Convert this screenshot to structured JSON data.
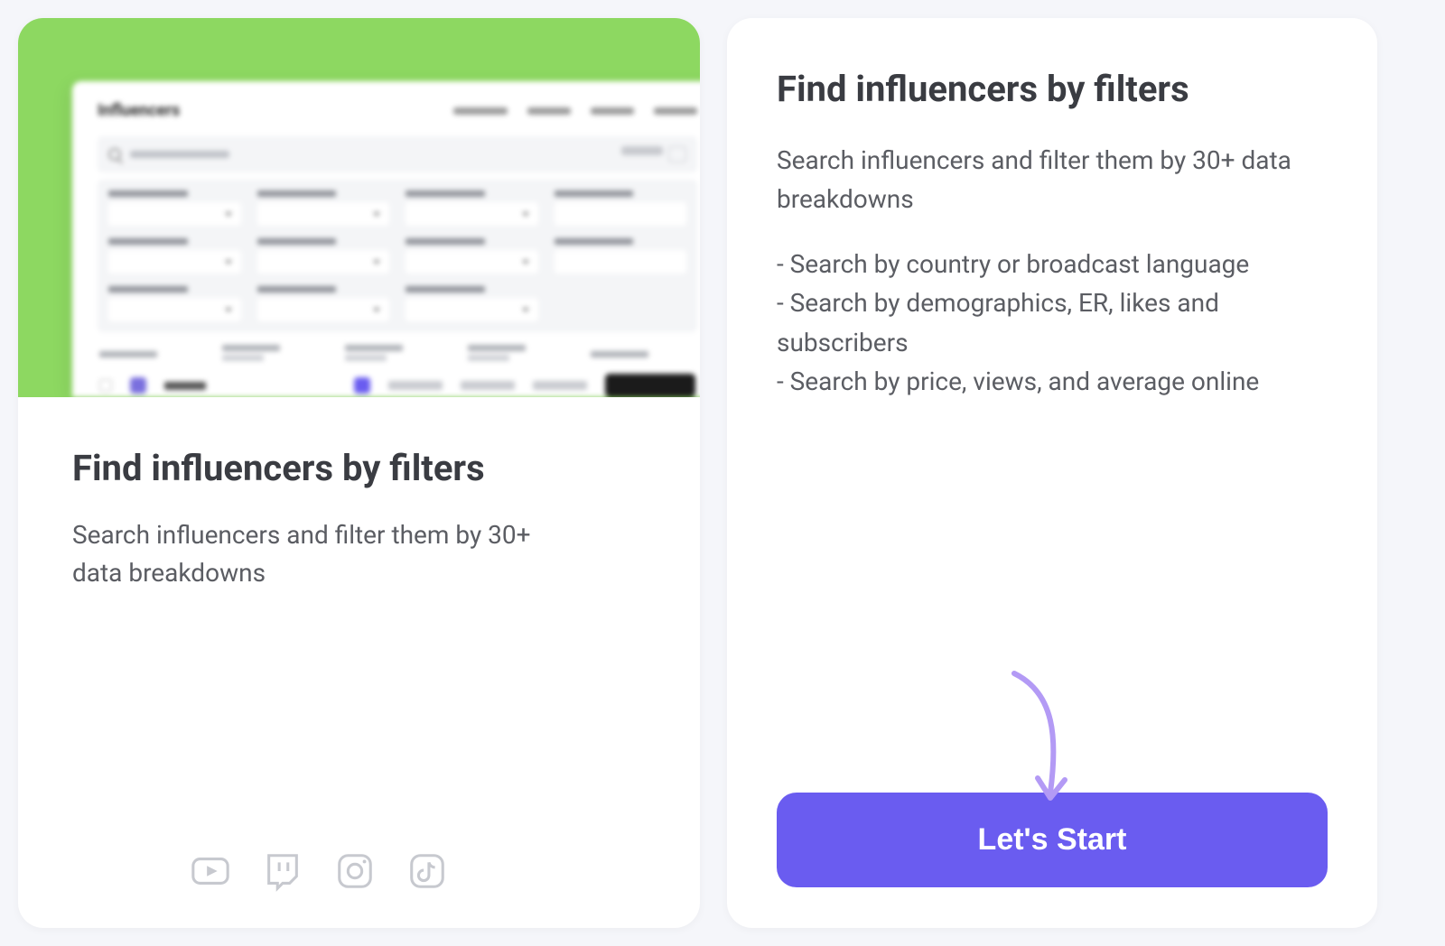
{
  "left": {
    "preview_title": "Influencers",
    "title": "Find influencers by filters",
    "subtitle": "Search influencers and filter them by 30+ data breakdowns",
    "platform_icons": [
      "youtube",
      "twitch",
      "instagram",
      "tiktok"
    ]
  },
  "right": {
    "title": "Find influencers by filters",
    "intro": "Search influencers and filter them by 30+ data breakdowns",
    "bullet1": "- Search by country or broadcast language",
    "bullet2": "- Search by demographics, ER, likes and subscribers",
    "bullet3": "- Search by price, views, and average online",
    "cta_label": "Let's Start"
  },
  "colors": {
    "accent_green": "#8dd861",
    "accent_purple": "#6a5cf0",
    "arrow_purple": "#b39af5"
  }
}
